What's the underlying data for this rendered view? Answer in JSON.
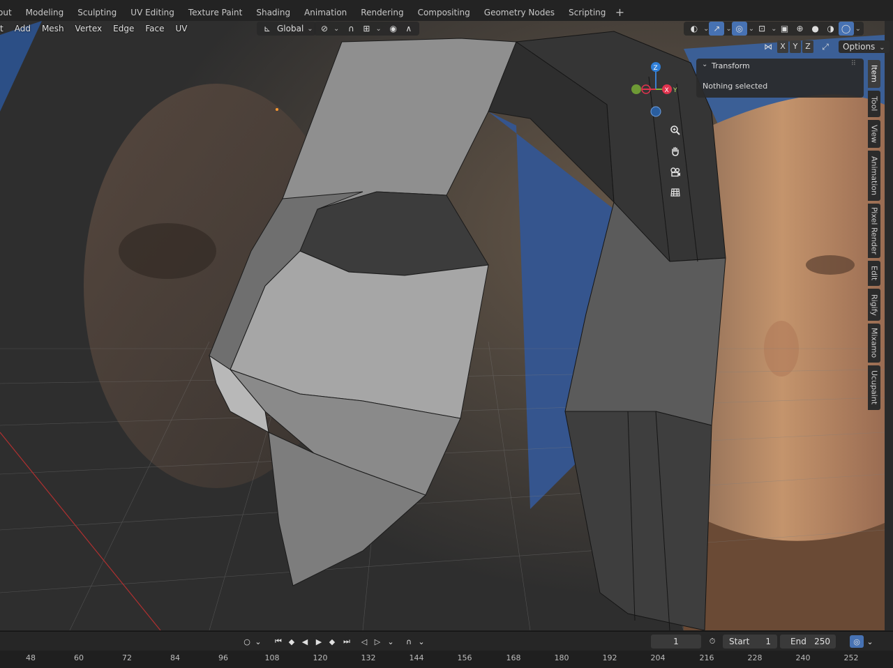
{
  "workspace_tabs": [
    "out",
    "Modeling",
    "Sculpting",
    "UV Editing",
    "Texture Paint",
    "Shading",
    "Animation",
    "Rendering",
    "Compositing",
    "Geometry Nodes",
    "Scripting"
  ],
  "workspace_add": "+",
  "viewport_menu": [
    "t",
    "Add",
    "Mesh",
    "Vertex",
    "Edge",
    "Face",
    "UV"
  ],
  "transform_orientation": "Global",
  "axis_buttons": [
    "X",
    "Y",
    "Z"
  ],
  "options_label": "Options",
  "gizmo": {
    "z": "Z",
    "y": "Y",
    "x": "X"
  },
  "transform_panel": {
    "title": "Transform",
    "message": "Nothing selected"
  },
  "side_tabs": [
    "Item",
    "Tool",
    "View",
    "Animation",
    "Pixel Render",
    "Edit",
    "Rigify",
    "Mixamo",
    "Ucupaint"
  ],
  "timeline": {
    "current_frame": "1",
    "start_label": "Start",
    "start_value": "1",
    "end_label": "End",
    "end_value": "250"
  },
  "ruler_ticks": [
    "48",
    "60",
    "72",
    "84",
    "96",
    "108",
    "120",
    "132",
    "144",
    "156",
    "168",
    "180",
    "192",
    "204",
    "216",
    "228",
    "240",
    "252"
  ],
  "icons": [
    "viewport-pivot-icon",
    "snap-magnet-icon",
    "proportional-edit-icon",
    "zoom-icon",
    "hand-pan-icon",
    "camera-icon",
    "grid-ortho-icon",
    "play-icon",
    "jump-start-icon",
    "jump-end-icon",
    "keyframe-prev-icon",
    "keyframe-next-icon",
    "stopwatch-icon"
  ],
  "colors": {
    "accent": "#4772b3",
    "axis_x": "#e0334e",
    "axis_y": "#7fb33a",
    "axis_z": "#2f7fd8"
  }
}
